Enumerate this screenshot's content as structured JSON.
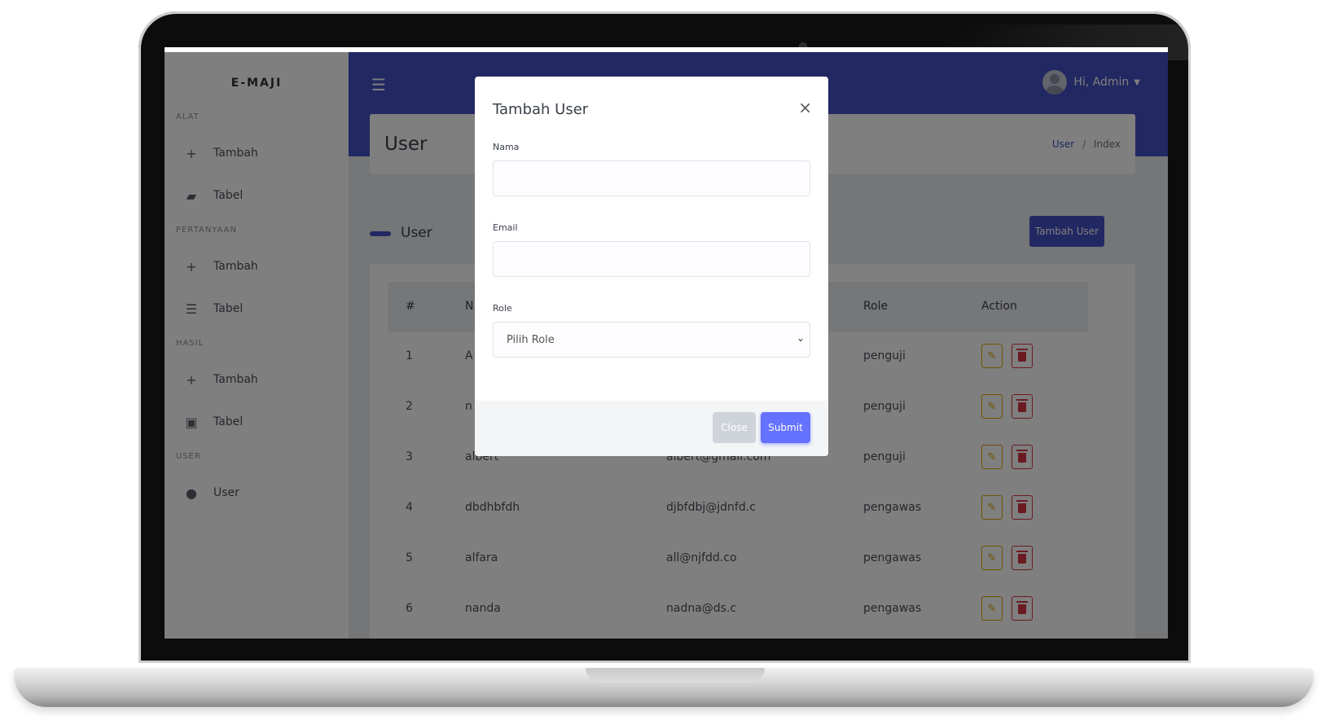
{
  "app": {
    "brand": "E-MAJI"
  },
  "sidebar": {
    "sections": [
      {
        "heading": "ALAT",
        "items": [
          {
            "label": "Tambah",
            "icon": "plus-icon"
          },
          {
            "label": "Tabel",
            "icon": "toolbox-icon"
          }
        ]
      },
      {
        "heading": "PERTANYAAN",
        "items": [
          {
            "label": "Tambah",
            "icon": "plus-icon"
          },
          {
            "label": "Tabel",
            "icon": "list-icon"
          }
        ]
      },
      {
        "heading": "HASIL",
        "items": [
          {
            "label": "Tambah",
            "icon": "plus-icon"
          },
          {
            "label": "Tabel",
            "icon": "book-icon"
          }
        ]
      },
      {
        "heading": "USER",
        "items": [
          {
            "label": "User",
            "icon": "user-icon"
          }
        ]
      }
    ]
  },
  "topbar": {
    "greeting": "Hi, Admin"
  },
  "page": {
    "title": "User",
    "breadcrumb": {
      "link": "User",
      "separator": "/",
      "current": "Index"
    },
    "section_title": "User",
    "add_button": "Tambah User"
  },
  "table": {
    "headers": [
      "#",
      "N",
      "Role",
      "Action"
    ],
    "rows": [
      {
        "no": "1",
        "name": "A",
        "email": "",
        "role": "penguji"
      },
      {
        "no": "2",
        "name": "n",
        "email": "",
        "role": "penguji"
      },
      {
        "no": "3",
        "name": "albert",
        "email": "albert@gmail.com",
        "role": "penguji"
      },
      {
        "no": "4",
        "name": "dbdhbfdh",
        "email": "djbfdbj@jdnfd.c",
        "role": "pengawas"
      },
      {
        "no": "5",
        "name": "alfara",
        "email": "all@njfdd.co",
        "role": "pengawas"
      },
      {
        "no": "6",
        "name": "nanda",
        "email": "nadna@ds.c",
        "role": "pengawas"
      }
    ]
  },
  "modal": {
    "title": "Tambah User",
    "close_symbol": "×",
    "fields": {
      "name_label": "Nama",
      "name_value": "",
      "email_label": "Email",
      "email_value": "",
      "role_label": "Role",
      "role_selected": "Pilih Role"
    },
    "close_button": "Close",
    "submit_button": "Submit"
  },
  "colors": {
    "primary": "#4450c5",
    "submit": "#6571ff",
    "edit": "#e0a400",
    "delete": "#d63545"
  }
}
